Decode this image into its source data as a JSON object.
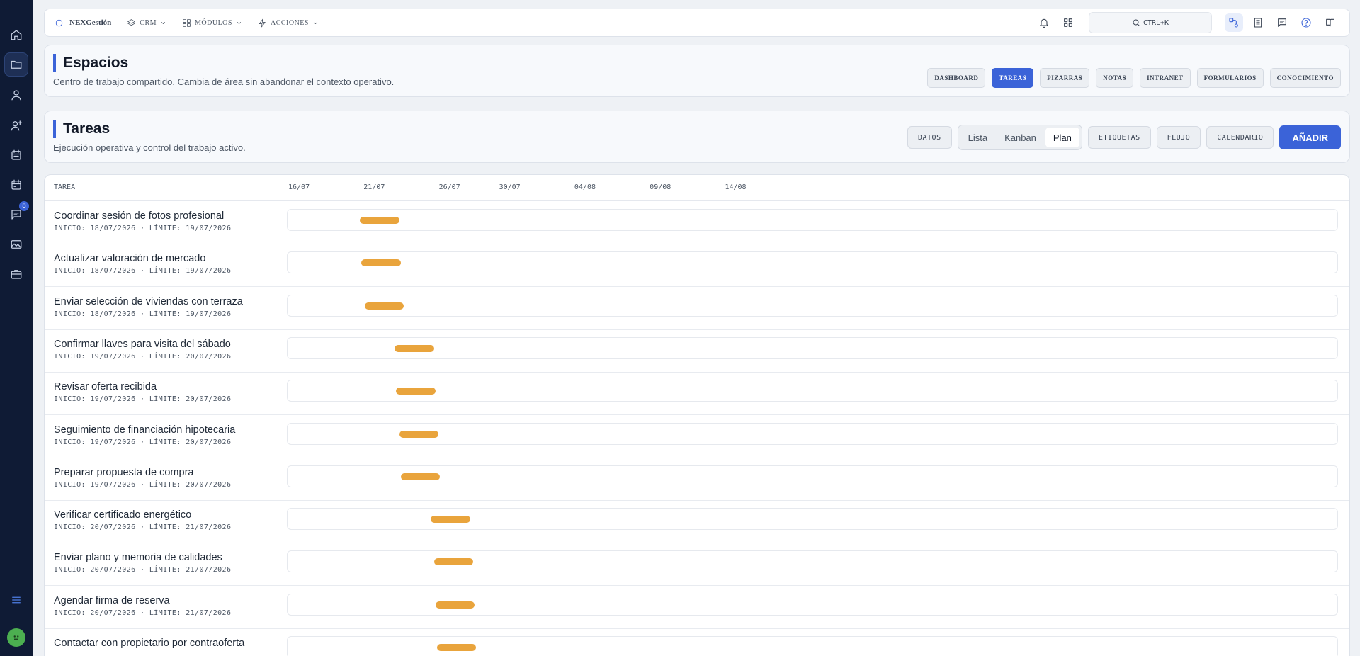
{
  "sidebar": {
    "items": [
      {
        "icon": "home-icon"
      },
      {
        "icon": "folder-icon",
        "active": true
      },
      {
        "icon": "user-icon"
      },
      {
        "icon": "user-plus-icon"
      },
      {
        "icon": "calendar-icon"
      },
      {
        "icon": "calendar-alt-icon"
      },
      {
        "icon": "chat-icon",
        "badge": "8"
      },
      {
        "icon": "image-icon"
      },
      {
        "icon": "briefcase-icon"
      }
    ],
    "badge": "8"
  },
  "topbar": {
    "brand": "NEXGestión",
    "menus": [
      {
        "label": "CRM"
      },
      {
        "label": "MÓDULOS"
      },
      {
        "label": "ACCIONES"
      }
    ],
    "search_label": "CTRL+K"
  },
  "espacios": {
    "title": "Espacios",
    "subtitle": "Centro de trabajo compartido. Cambia de área sin abandonar el contexto operativo.",
    "tabs": [
      {
        "label": "DASHBOARD"
      },
      {
        "label": "TAREAS"
      },
      {
        "label": "PIZARRAS"
      },
      {
        "label": "NOTAS"
      },
      {
        "label": "INTRANET"
      },
      {
        "label": "FORMULARIOS"
      },
      {
        "label": "CONOCIMIENTO"
      }
    ]
  },
  "tareas": {
    "title": "Tareas",
    "subtitle": "Ejecución operativa y control del trabajo activo.",
    "datos": "DATOS",
    "views": [
      {
        "label": "Lista"
      },
      {
        "label": "Kanban"
      },
      {
        "label": "Plan"
      }
    ],
    "etiquetas": "ETIQUETAS",
    "flujo": "FLUJO",
    "calendario": "CALENDARIO",
    "add": "AÑADIR"
  },
  "gantt": {
    "column_header": "TAREA",
    "timeline_ticks": [
      "16/07",
      "21/07",
      "26/07",
      "30/07",
      "04/08",
      "09/08",
      "14/08"
    ],
    "rows": [
      {
        "title": "Coordinar sesión de fotos profesional",
        "meta": "INICIO: 18/07/2026 · LÍMITE: 19/07/2026",
        "start": 2.4,
        "end": 3.7
      },
      {
        "title": "Actualizar valoración de mercado",
        "meta": "INICIO: 18/07/2026 · LÍMITE: 19/07/2026",
        "start": 2.45,
        "end": 3.75
      },
      {
        "title": "Enviar selección de viviendas con terraza",
        "meta": "INICIO: 18/07/2026 · LÍMITE: 19/07/2026",
        "start": 2.55,
        "end": 3.85
      },
      {
        "title": "Confirmar llaves para visita del sábado",
        "meta": "INICIO: 19/07/2026 · LÍMITE: 20/07/2026",
        "start": 3.55,
        "end": 4.85
      },
      {
        "title": "Revisar oferta recibida",
        "meta": "INICIO: 19/07/2026 · LÍMITE: 20/07/2026",
        "start": 3.6,
        "end": 4.9
      },
      {
        "title": "Seguimiento de financiación hipotecaria",
        "meta": "INICIO: 19/07/2026 · LÍMITE: 20/07/2026",
        "start": 3.7,
        "end": 5.0
      },
      {
        "title": "Preparar propuesta de compra",
        "meta": "INICIO: 19/07/2026 · LÍMITE: 20/07/2026",
        "start": 3.75,
        "end": 5.05
      },
      {
        "title": "Verificar certificado energético",
        "meta": "INICIO: 20/07/2026 · LÍMITE: 21/07/2026",
        "start": 4.75,
        "end": 6.05
      },
      {
        "title": "Enviar plano y memoria de calidades",
        "meta": "INICIO: 20/07/2026 · LÍMITE: 21/07/2026",
        "start": 4.85,
        "end": 6.15
      },
      {
        "title": "Agendar firma de reserva",
        "meta": "INICIO: 20/07/2026 · LÍMITE: 21/07/2026",
        "start": 4.9,
        "end": 6.2
      },
      {
        "title": "Contactar con propietario por contraoferta",
        "meta": "",
        "start": 4.95,
        "end": 6.25
      }
    ]
  },
  "colors": {
    "accent": "#3b63d8",
    "bar": "#e9a43c",
    "sidebar": "#0f1b35"
  }
}
